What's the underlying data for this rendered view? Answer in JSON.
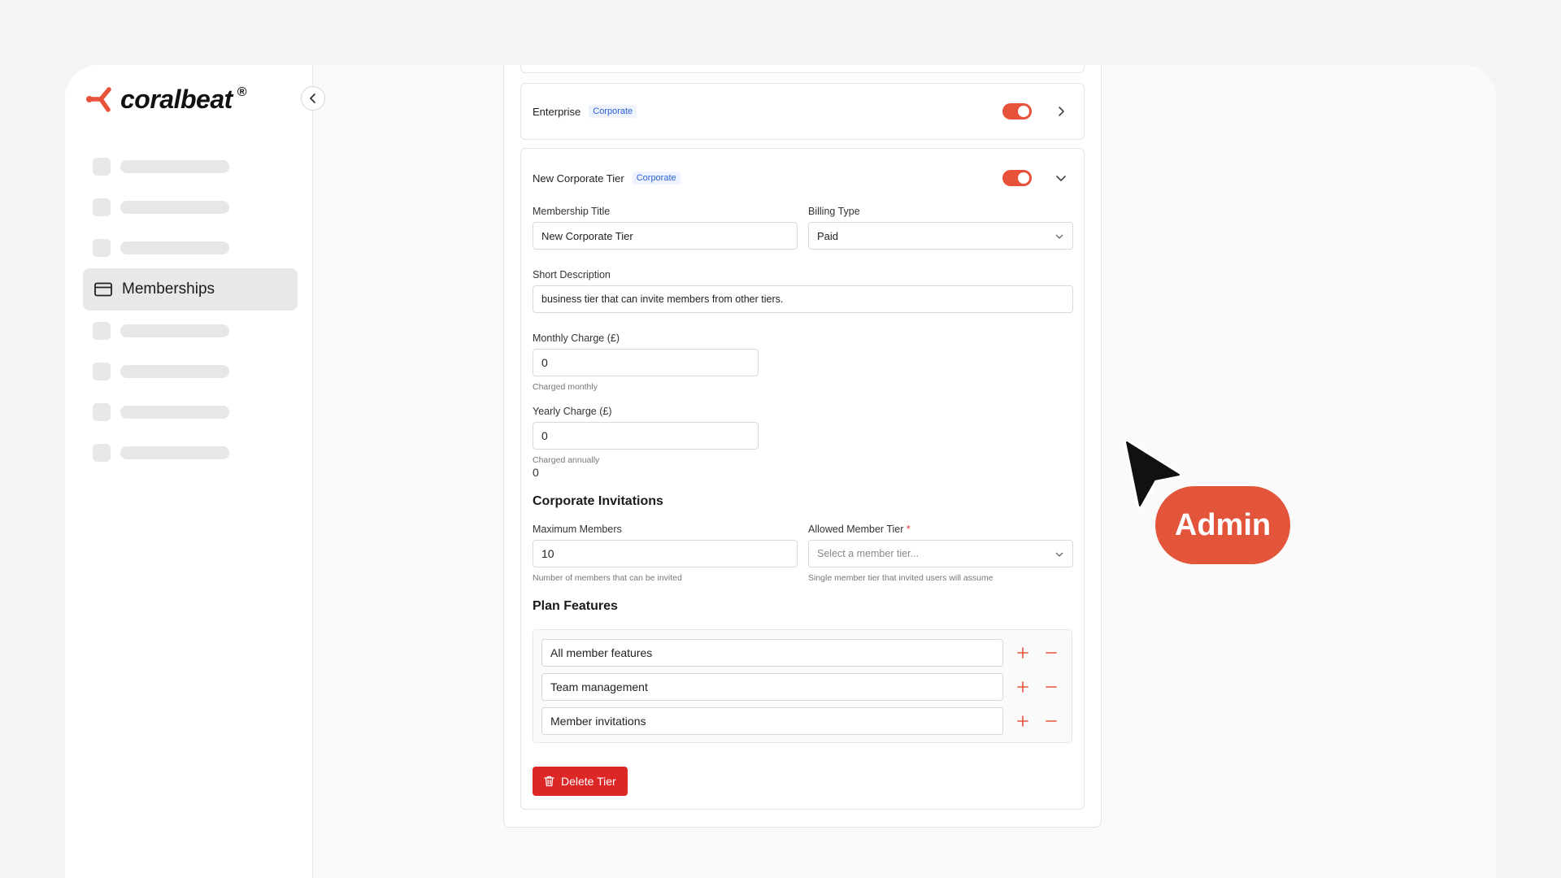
{
  "brand": {
    "name": "coralbeat",
    "registered": "®"
  },
  "sidebar": {
    "active_item": {
      "label": "Memberships",
      "icon": "credit-card-icon"
    }
  },
  "tiers": {
    "enterprise": {
      "name": "Enterprise",
      "badge": "Corporate",
      "enabled": true
    },
    "new_tier": {
      "name": "New Corporate Tier",
      "badge": "Corporate",
      "enabled": true,
      "form": {
        "title_label": "Membership Title",
        "title_value": "New Corporate Tier",
        "billing_label": "Billing Type",
        "billing_value": "Paid",
        "desc_label": "Short Description",
        "desc_value": "business tier that can invite members from other tiers.",
        "monthly_label": "Monthly Charge (£)",
        "monthly_value": "0",
        "monthly_help": "Charged monthly",
        "yearly_label": "Yearly Charge (£)",
        "yearly_value": "0",
        "yearly_help": "Charged annually",
        "yearly_echo": "0"
      },
      "invitations": {
        "heading": "Corporate Invitations",
        "max_label": "Maximum Members",
        "max_value": "10",
        "max_help": "Number of members that can be invited",
        "tier_label": "Allowed Member Tier",
        "tier_required": "*",
        "tier_placeholder": "Select a member tier...",
        "tier_help": "Single member tier that invited users will assume"
      },
      "features": {
        "heading": "Plan Features",
        "items": [
          "All member features",
          "Team management",
          "Member invitations"
        ]
      },
      "delete_label": "Delete Tier"
    }
  },
  "overlay": {
    "role_label": "Admin"
  },
  "colors": {
    "accent": "#e8513a",
    "danger": "#dd2727",
    "badge": "#2c62d6"
  }
}
